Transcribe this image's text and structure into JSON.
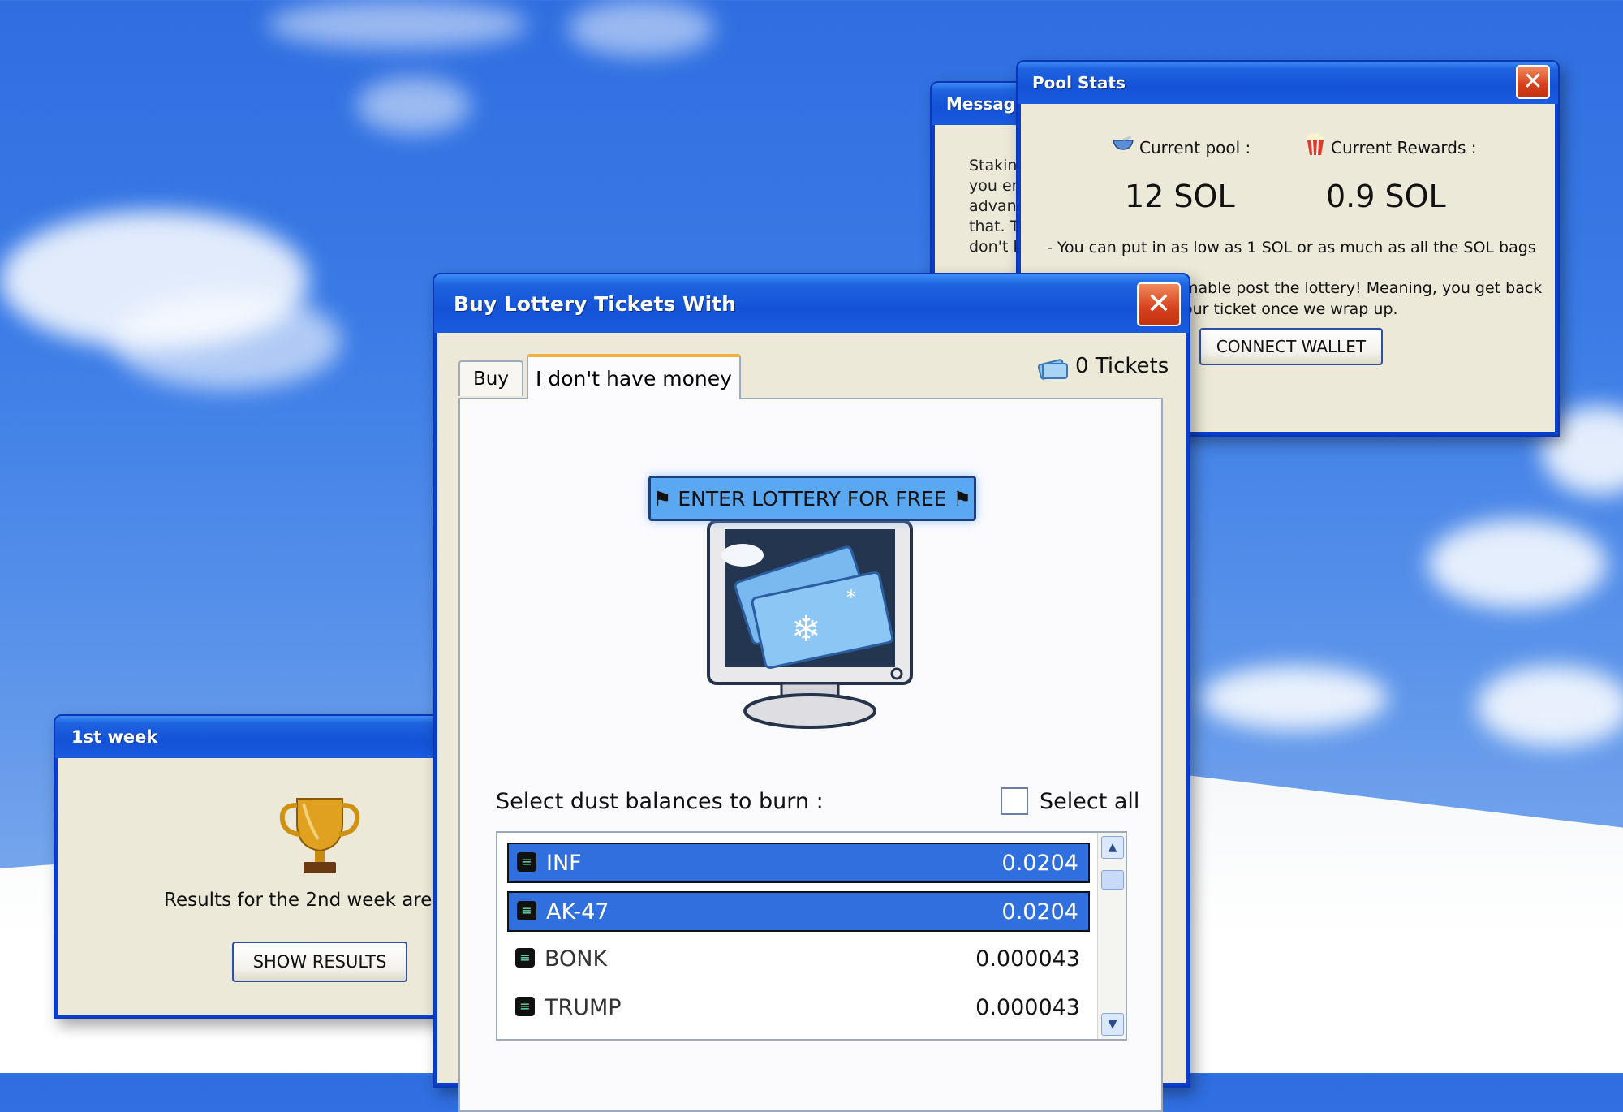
{
  "message_window": {
    "title": "Message",
    "text_lines": [
      "Stakin",
      "you er",
      "advan",
      "that. T",
      "don't b"
    ]
  },
  "pool_stats": {
    "title": "Pool Stats",
    "current_pool_label": "Current pool :",
    "current_pool_value": "12 SOL",
    "current_rewards_label": "Current Rewards :",
    "current_rewards_value": "0.9 SOL",
    "note_1": "- You can put in as low as 1 SOL or as much as all the SOL bags",
    "note_2_line1": "mable post the lottery! Meaning, you get back",
    "note_2_line2": "our ticket once we wrap up.",
    "connect_label": "CONNECT WALLET"
  },
  "first_week": {
    "title": "1st week",
    "results_text": "Results for the 2nd week are o",
    "show_results_label": "SHOW RESULTS"
  },
  "lottery": {
    "title": "Buy Lottery Tickets With",
    "tabs": [
      {
        "label": "Buy",
        "active": false
      },
      {
        "label": "I don't have money",
        "active": true
      }
    ],
    "tickets_label": "0 Tickets",
    "enter_label": "ENTER LOTTERY FOR FREE",
    "select_prompt": "Select dust balances to burn :",
    "select_all_label": "Select all",
    "tokens": [
      {
        "name": "INF",
        "amount": "0.0204",
        "selected": true
      },
      {
        "name": "AK-47",
        "amount": "0.0204",
        "selected": true
      },
      {
        "name": "BONK",
        "amount": "0.000043",
        "selected": false
      },
      {
        "name": "TRUMP",
        "amount": "0.000043",
        "selected": false
      }
    ]
  },
  "colors": {
    "selection": "#2f6fde",
    "xp_titlebar": "#1452d6",
    "xp_body": "#ece9d8",
    "close_red": "#d6401e"
  }
}
